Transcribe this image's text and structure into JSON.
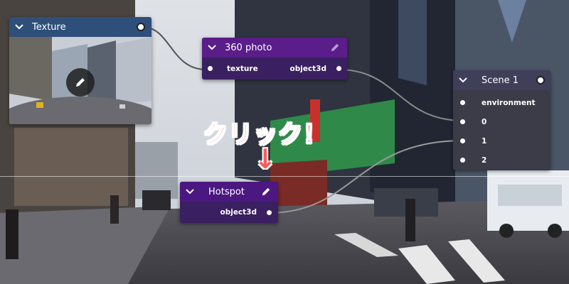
{
  "colors": {
    "texture_header": "#2e4f7a",
    "photo_header": "#5a1d8a",
    "scene_header": "#3f3f5a",
    "hotspot_header": "#4b1780",
    "node_body": "#3a3946",
    "annotation": "#ff5a5a"
  },
  "texture_node": {
    "title": "Texture"
  },
  "photo_node": {
    "title": "360 photo",
    "ports": {
      "input": "texture",
      "output": "object3d"
    }
  },
  "scene_node": {
    "title": "Scene 1",
    "ports": [
      "environment",
      "0",
      "1",
      "2"
    ]
  },
  "hotspot_node": {
    "title": "Hotspot",
    "ports": {
      "output": "object3d"
    }
  },
  "annotation": {
    "text": "クリック！",
    "arrow": "↓"
  },
  "icons": {
    "chevron": "chevron-down-icon",
    "pencil": "pencil-icon",
    "port": "port-dot-icon"
  }
}
